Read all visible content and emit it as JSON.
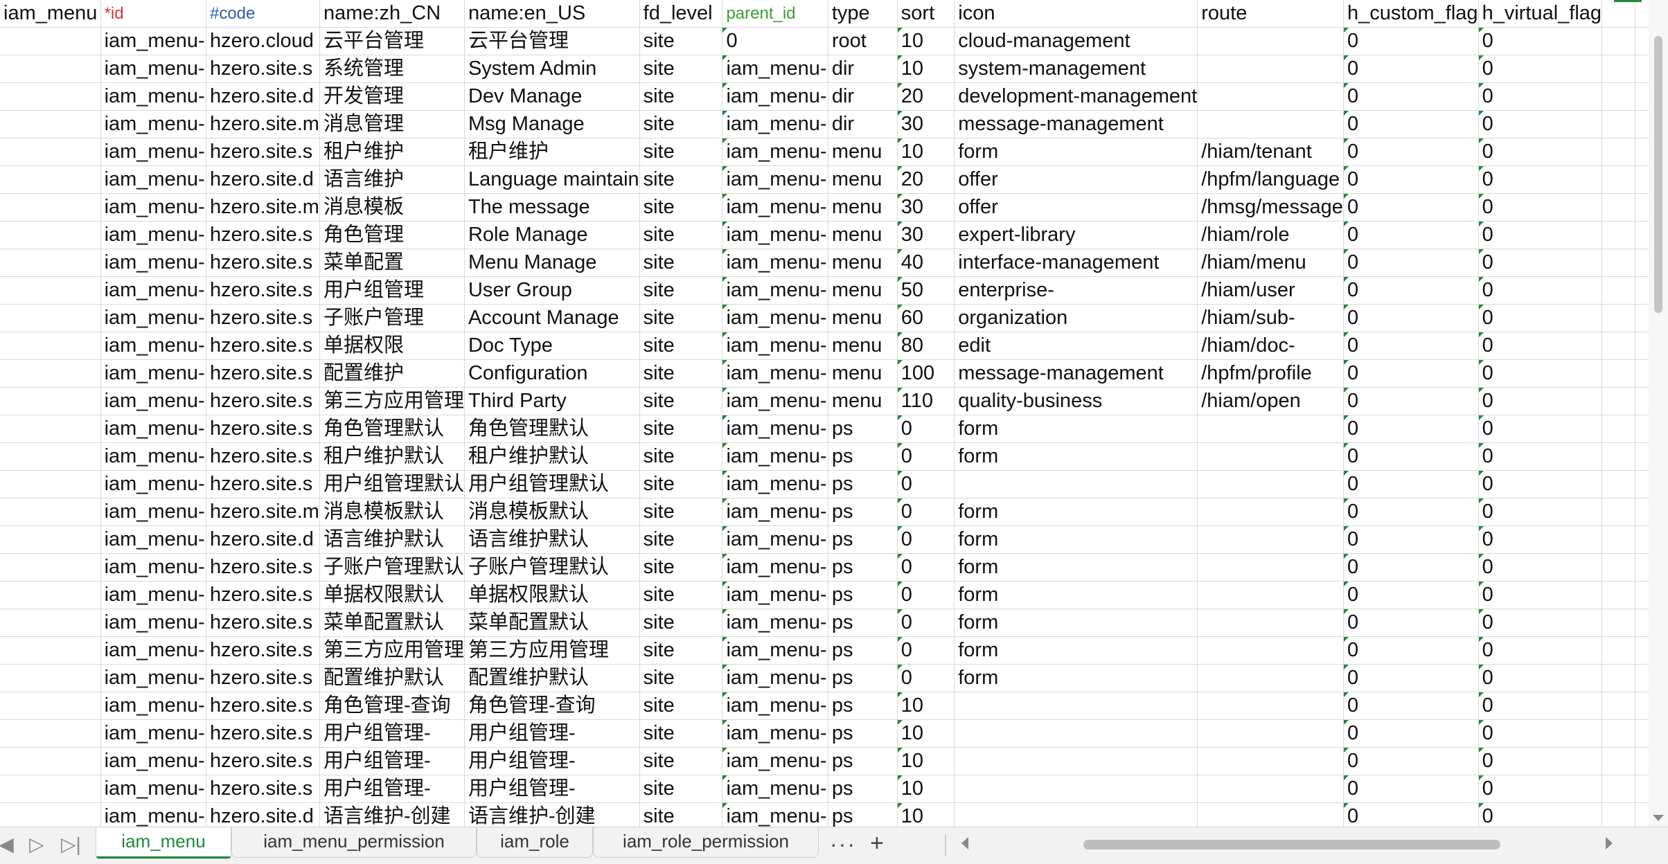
{
  "sheet": {
    "header": [
      "iam_menu",
      "*id",
      "#code",
      "name:zh_CN",
      "name:en_US",
      "fd_level",
      "parent_id",
      "type",
      "sort",
      "icon",
      "route",
      "h_custom_flag",
      "h_virtual_flag",
      "",
      ""
    ],
    "rows": [
      [
        "",
        "iam_menu-",
        "hzero.cloud",
        "云平台管理",
        "云平台管理",
        "site",
        "0",
        "root",
        "10",
        "cloud-management",
        "",
        "0",
        "0",
        "",
        ""
      ],
      [
        "",
        "iam_menu-",
        "hzero.site.s",
        "系统管理",
        "System Admin",
        "site",
        "iam_menu-",
        "dir",
        "10",
        "system-management",
        "",
        "0",
        "0",
        "",
        ""
      ],
      [
        "",
        "iam_menu-",
        "hzero.site.d",
        "开发管理",
        "Dev Manage",
        "site",
        "iam_menu-",
        "dir",
        "20",
        "development-management",
        "",
        "0",
        "0",
        "",
        ""
      ],
      [
        "",
        "iam_menu-",
        "hzero.site.m",
        "消息管理",
        "Msg Manage",
        "site",
        "iam_menu-",
        "dir",
        "30",
        "message-management",
        "",
        "0",
        "0",
        "",
        ""
      ],
      [
        "",
        "iam_menu-",
        "hzero.site.s",
        "租户维护",
        "租户维护",
        "site",
        "iam_menu-",
        "menu",
        "10",
        "form",
        "/hiam/tenant",
        "0",
        "0",
        "",
        ""
      ],
      [
        "",
        "iam_menu-",
        "hzero.site.d",
        "语言维护",
        "Language maintain",
        "site",
        "iam_menu-",
        "menu",
        "20",
        "offer",
        "/hpfm/language",
        "0",
        "0",
        "",
        ""
      ],
      [
        "",
        "iam_menu-",
        "hzero.site.m",
        "消息模板",
        "The message",
        "site",
        "iam_menu-",
        "menu",
        "30",
        "offer",
        "/hmsg/message",
        "0",
        "0",
        "",
        ""
      ],
      [
        "",
        "iam_menu-",
        "hzero.site.s",
        "角色管理",
        "Role Manage",
        "site",
        "iam_menu-",
        "menu",
        "30",
        "expert-library",
        "/hiam/role",
        "0",
        "0",
        "",
        ""
      ],
      [
        "",
        "iam_menu-",
        "hzero.site.s",
        "菜单配置",
        "Menu Manage",
        "site",
        "iam_menu-",
        "menu",
        "40",
        "interface-management",
        "/hiam/menu",
        "0",
        "0",
        "",
        ""
      ],
      [
        "",
        "iam_menu-",
        "hzero.site.s",
        "用户组管理",
        "User Group",
        "site",
        "iam_menu-",
        "menu",
        "50",
        "enterprise-",
        "/hiam/user",
        "0",
        "0",
        "",
        ""
      ],
      [
        "",
        "iam_menu-",
        "hzero.site.s",
        "子账户管理",
        "Account Manage",
        "site",
        "iam_menu-",
        "menu",
        "60",
        "organization",
        "/hiam/sub-",
        "0",
        "0",
        "",
        ""
      ],
      [
        "",
        "iam_menu-",
        "hzero.site.s",
        "单据权限",
        "Doc Type",
        "site",
        "iam_menu-",
        "menu",
        "80",
        "edit",
        "/hiam/doc-",
        "0",
        "0",
        "",
        ""
      ],
      [
        "",
        "iam_menu-",
        "hzero.site.s",
        "配置维护",
        "Configuration",
        "site",
        "iam_menu-",
        "menu",
        "100",
        "message-management",
        "/hpfm/profile",
        "0",
        "0",
        "",
        ""
      ],
      [
        "",
        "iam_menu-",
        "hzero.site.s",
        "第三方应用管理",
        "Third Party",
        "site",
        "iam_menu-",
        "menu",
        "110",
        "quality-business",
        "/hiam/open",
        "0",
        "0",
        "",
        ""
      ],
      [
        "",
        "iam_menu-",
        "hzero.site.s",
        "角色管理默认",
        "角色管理默认",
        "site",
        "iam_menu-",
        "ps",
        "0",
        "form",
        "",
        "0",
        "0",
        "",
        ""
      ],
      [
        "",
        "iam_menu-",
        "hzero.site.s",
        "租户维护默认",
        "租户维护默认",
        "site",
        "iam_menu-",
        "ps",
        "0",
        "form",
        "",
        "0",
        "0",
        "",
        ""
      ],
      [
        "",
        "iam_menu-",
        "hzero.site.s",
        "用户组管理默认",
        "用户组管理默认",
        "site",
        "iam_menu-",
        "ps",
        "0",
        "",
        "",
        "0",
        "0",
        "",
        ""
      ],
      [
        "",
        "iam_menu-",
        "hzero.site.m",
        "消息模板默认",
        "消息模板默认",
        "site",
        "iam_menu-",
        "ps",
        "0",
        "form",
        "",
        "0",
        "0",
        "",
        ""
      ],
      [
        "",
        "iam_menu-",
        "hzero.site.d",
        "语言维护默认",
        "语言维护默认",
        "site",
        "iam_menu-",
        "ps",
        "0",
        "form",
        "",
        "0",
        "0",
        "",
        ""
      ],
      [
        "",
        "iam_menu-",
        "hzero.site.s",
        "子账户管理默认",
        "子账户管理默认",
        "site",
        "iam_menu-",
        "ps",
        "0",
        "form",
        "",
        "0",
        "0",
        "",
        ""
      ],
      [
        "",
        "iam_menu-",
        "hzero.site.s",
        "单据权限默认",
        "单据权限默认",
        "site",
        "iam_menu-",
        "ps",
        "0",
        "form",
        "",
        "0",
        "0",
        "",
        ""
      ],
      [
        "",
        "iam_menu-",
        "hzero.site.s",
        "菜单配置默认",
        "菜单配置默认",
        "site",
        "iam_menu-",
        "ps",
        "0",
        "form",
        "",
        "0",
        "0",
        "",
        ""
      ],
      [
        "",
        "iam_menu-",
        "hzero.site.s",
        "第三方应用管理",
        "第三方应用管理",
        "site",
        "iam_menu-",
        "ps",
        "0",
        "form",
        "",
        "0",
        "0",
        "",
        ""
      ],
      [
        "",
        "iam_menu-",
        "hzero.site.s",
        "配置维护默认",
        "配置维护默认",
        "site",
        "iam_menu-",
        "ps",
        "0",
        "form",
        "",
        "0",
        "0",
        "",
        ""
      ],
      [
        "",
        "iam_menu-",
        "hzero.site.s",
        "角色管理-查询",
        "角色管理-查询",
        "site",
        "iam_menu-",
        "ps",
        "10",
        "",
        "",
        "0",
        "0",
        "",
        ""
      ],
      [
        "",
        "iam_menu-",
        "hzero.site.s",
        "用户组管理-",
        "用户组管理-",
        "site",
        "iam_menu-",
        "ps",
        "10",
        "",
        "",
        "0",
        "0",
        "",
        ""
      ],
      [
        "",
        "iam_menu-",
        "hzero.site.s",
        "用户组管理-",
        "用户组管理-",
        "site",
        "iam_menu-",
        "ps",
        "10",
        "",
        "",
        "0",
        "0",
        "",
        ""
      ],
      [
        "",
        "iam_menu-",
        "hzero.site.s",
        "用户组管理-",
        "用户组管理-",
        "site",
        "iam_menu-",
        "ps",
        "10",
        "",
        "",
        "0",
        "0",
        "",
        ""
      ],
      [
        "",
        "iam_menu-",
        "hzero.site.d",
        "语言维护-创建",
        "语言维护-创建",
        "site",
        "iam_menu-",
        "ps",
        "10",
        "",
        "",
        "0",
        "0",
        "",
        ""
      ]
    ]
  },
  "tabs": [
    {
      "label": "iam_menu",
      "active": true
    },
    {
      "label": "iam_menu_permission",
      "active": false
    },
    {
      "label": "iam_role",
      "active": false
    },
    {
      "label": "iam_role_permission",
      "active": false
    }
  ],
  "tabbar": {
    "first_icon": "first-sheet-icon",
    "prev_icon": "previous-sheet-icon",
    "last_icon": "last-sheet-icon",
    "more_label": "···",
    "add_label": "+"
  },
  "colors": {
    "accent": "#1f8a3a",
    "id_header": "#d6392f",
    "code_header": "#2d5fa8",
    "parent_header": "#3aa02f"
  }
}
